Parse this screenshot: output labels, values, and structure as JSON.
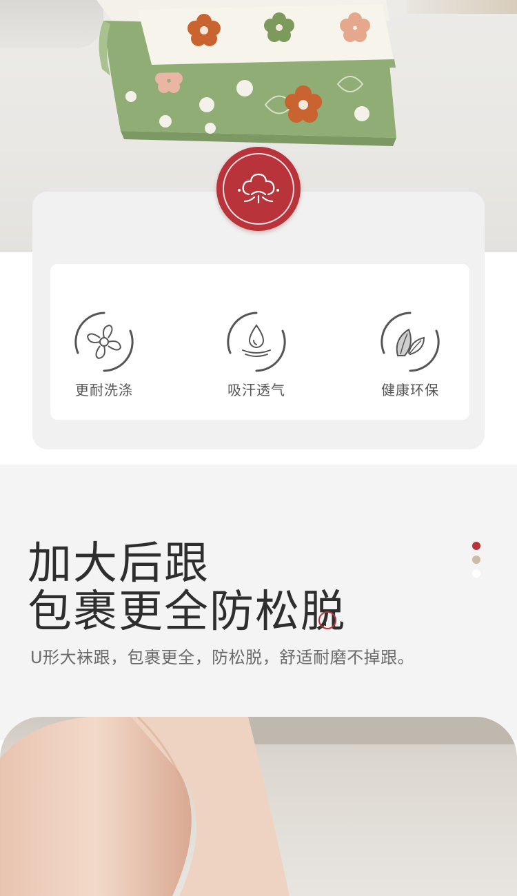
{
  "feature_card": {
    "badge_icon": "cotton-icon",
    "items": [
      {
        "icon": "washable-icon",
        "label": "更耐洗涤"
      },
      {
        "icon": "sweat-absorb-icon",
        "label": "吸汗透气"
      },
      {
        "icon": "eco-leaf-icon",
        "label": "健康环保"
      }
    ]
  },
  "section": {
    "headline_line1": "加大后跟",
    "headline_line2": "包裹更全防松脱",
    "description": "U形大袜跟，包裹更全，防松脱，舒适耐磨不掉跟。"
  },
  "colors": {
    "accent": "#b8333a",
    "dot_colors": [
      "#b8333a",
      "#cdbba5",
      "#ffffff"
    ]
  }
}
